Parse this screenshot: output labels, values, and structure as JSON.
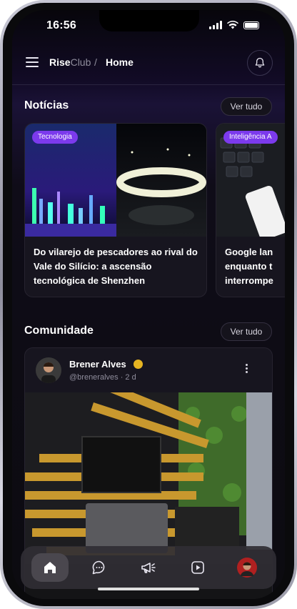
{
  "status_bar": {
    "time": "16:56"
  },
  "header": {
    "brand_bold": "Rise",
    "brand_light": "Club",
    "separator": "/",
    "current": "Home"
  },
  "news": {
    "title": "Notícias",
    "see_all": "Ver tudo",
    "items": [
      {
        "tag": "Tecnologia",
        "title": "Do vilarejo de pescadores ao rival do Vale do Silício: a ascensão tecnológica de Shenzhen"
      },
      {
        "tag": "Inteligência A",
        "title": "Google lan enquanto t interrompe"
      }
    ]
  },
  "community": {
    "title": "Comunidade",
    "see_all": "Ver tudo",
    "post": {
      "user": "Brener Alves",
      "handle": "@breneralves · 2 d"
    }
  },
  "colors": {
    "accent": "#7c3aed",
    "verified": "#e6b422"
  },
  "nav": {
    "items": [
      "home-icon",
      "chat-icon",
      "megaphone-icon",
      "video-icon",
      "profile-avatar"
    ],
    "active": 0
  }
}
